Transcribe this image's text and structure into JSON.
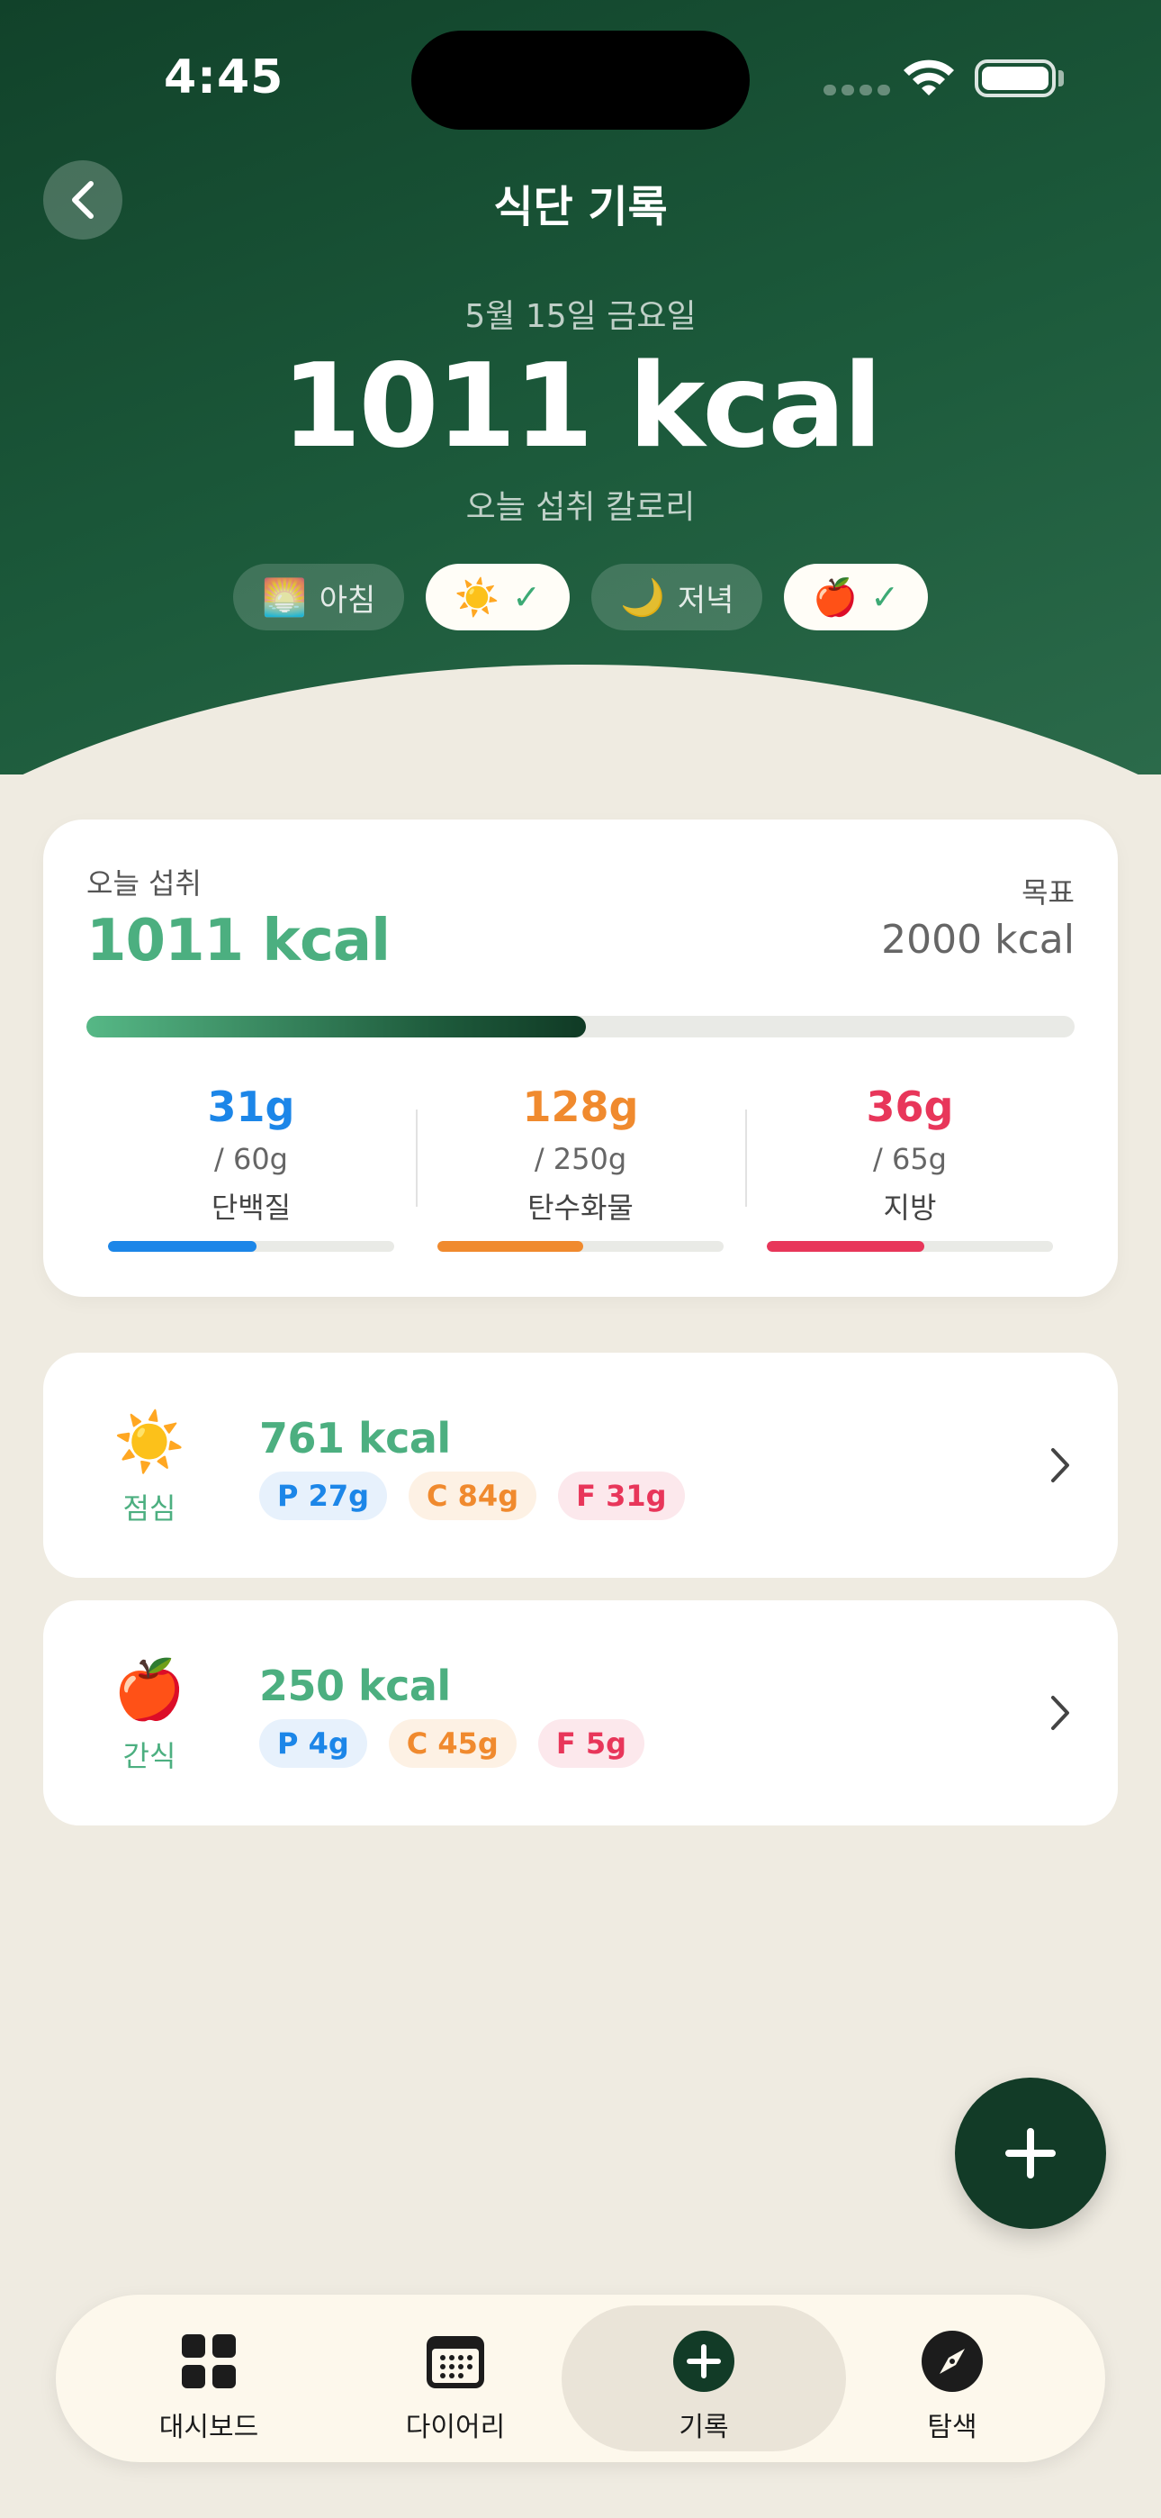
{
  "status_bar": {
    "time": "4:45"
  },
  "header": {
    "title": "식단 기록",
    "date": "5월 15일 금요일",
    "total_kcal": "1011 kcal",
    "subtitle": "오늘 섭취 칼로리",
    "meals": [
      {
        "emoji": "🌅",
        "label": "아침",
        "state": "muted"
      },
      {
        "emoji": "☀️",
        "label": "✓",
        "state": "active"
      },
      {
        "emoji": "🌙",
        "label": "저녁",
        "state": "muted"
      },
      {
        "emoji": "🍎",
        "label": "✓",
        "state": "active"
      }
    ]
  },
  "summary": {
    "label": "오늘 섭취",
    "kcal": "1011 kcal",
    "goal_label": "목표",
    "goal": "2000 kcal",
    "progress_fraction": 0.5055,
    "macros": [
      {
        "value": "31g",
        "goal": "/ 60g",
        "name": "단백질",
        "color": "#1C86E8",
        "fraction": 0.52
      },
      {
        "value": "128g",
        "goal": "/ 250g",
        "name": "탄수화물",
        "color": "#F08A2E",
        "fraction": 0.51
      },
      {
        "value": "36g",
        "goal": "/ 65g",
        "name": "지방",
        "color": "#E8365A",
        "fraction": 0.55
      }
    ]
  },
  "meal_cards": [
    {
      "emoji": "☀️",
      "name": "점심",
      "kcal": "761 kcal",
      "protein": "P 27g",
      "carbs": "C 84g",
      "fat": "F 31g"
    },
    {
      "emoji": "🍎",
      "name": "간식",
      "kcal": "250 kcal",
      "protein": "P 4g",
      "carbs": "C 45g",
      "fat": "F 5g"
    }
  ],
  "tabbar": {
    "items": [
      {
        "label": "대시보드",
        "icon": "grid-icon"
      },
      {
        "label": "다이어리",
        "icon": "calendar-icon"
      },
      {
        "label": "기록",
        "icon": "plus-circle-icon",
        "active": true
      },
      {
        "label": "탐색",
        "icon": "compass-icon"
      }
    ]
  },
  "colors": {
    "header_dark": "#11422A",
    "accent_green": "#4CAF80",
    "protein": "#1C86E8",
    "carbs": "#F08A2E",
    "fat": "#E8365A",
    "background": "#EFEBE1"
  }
}
